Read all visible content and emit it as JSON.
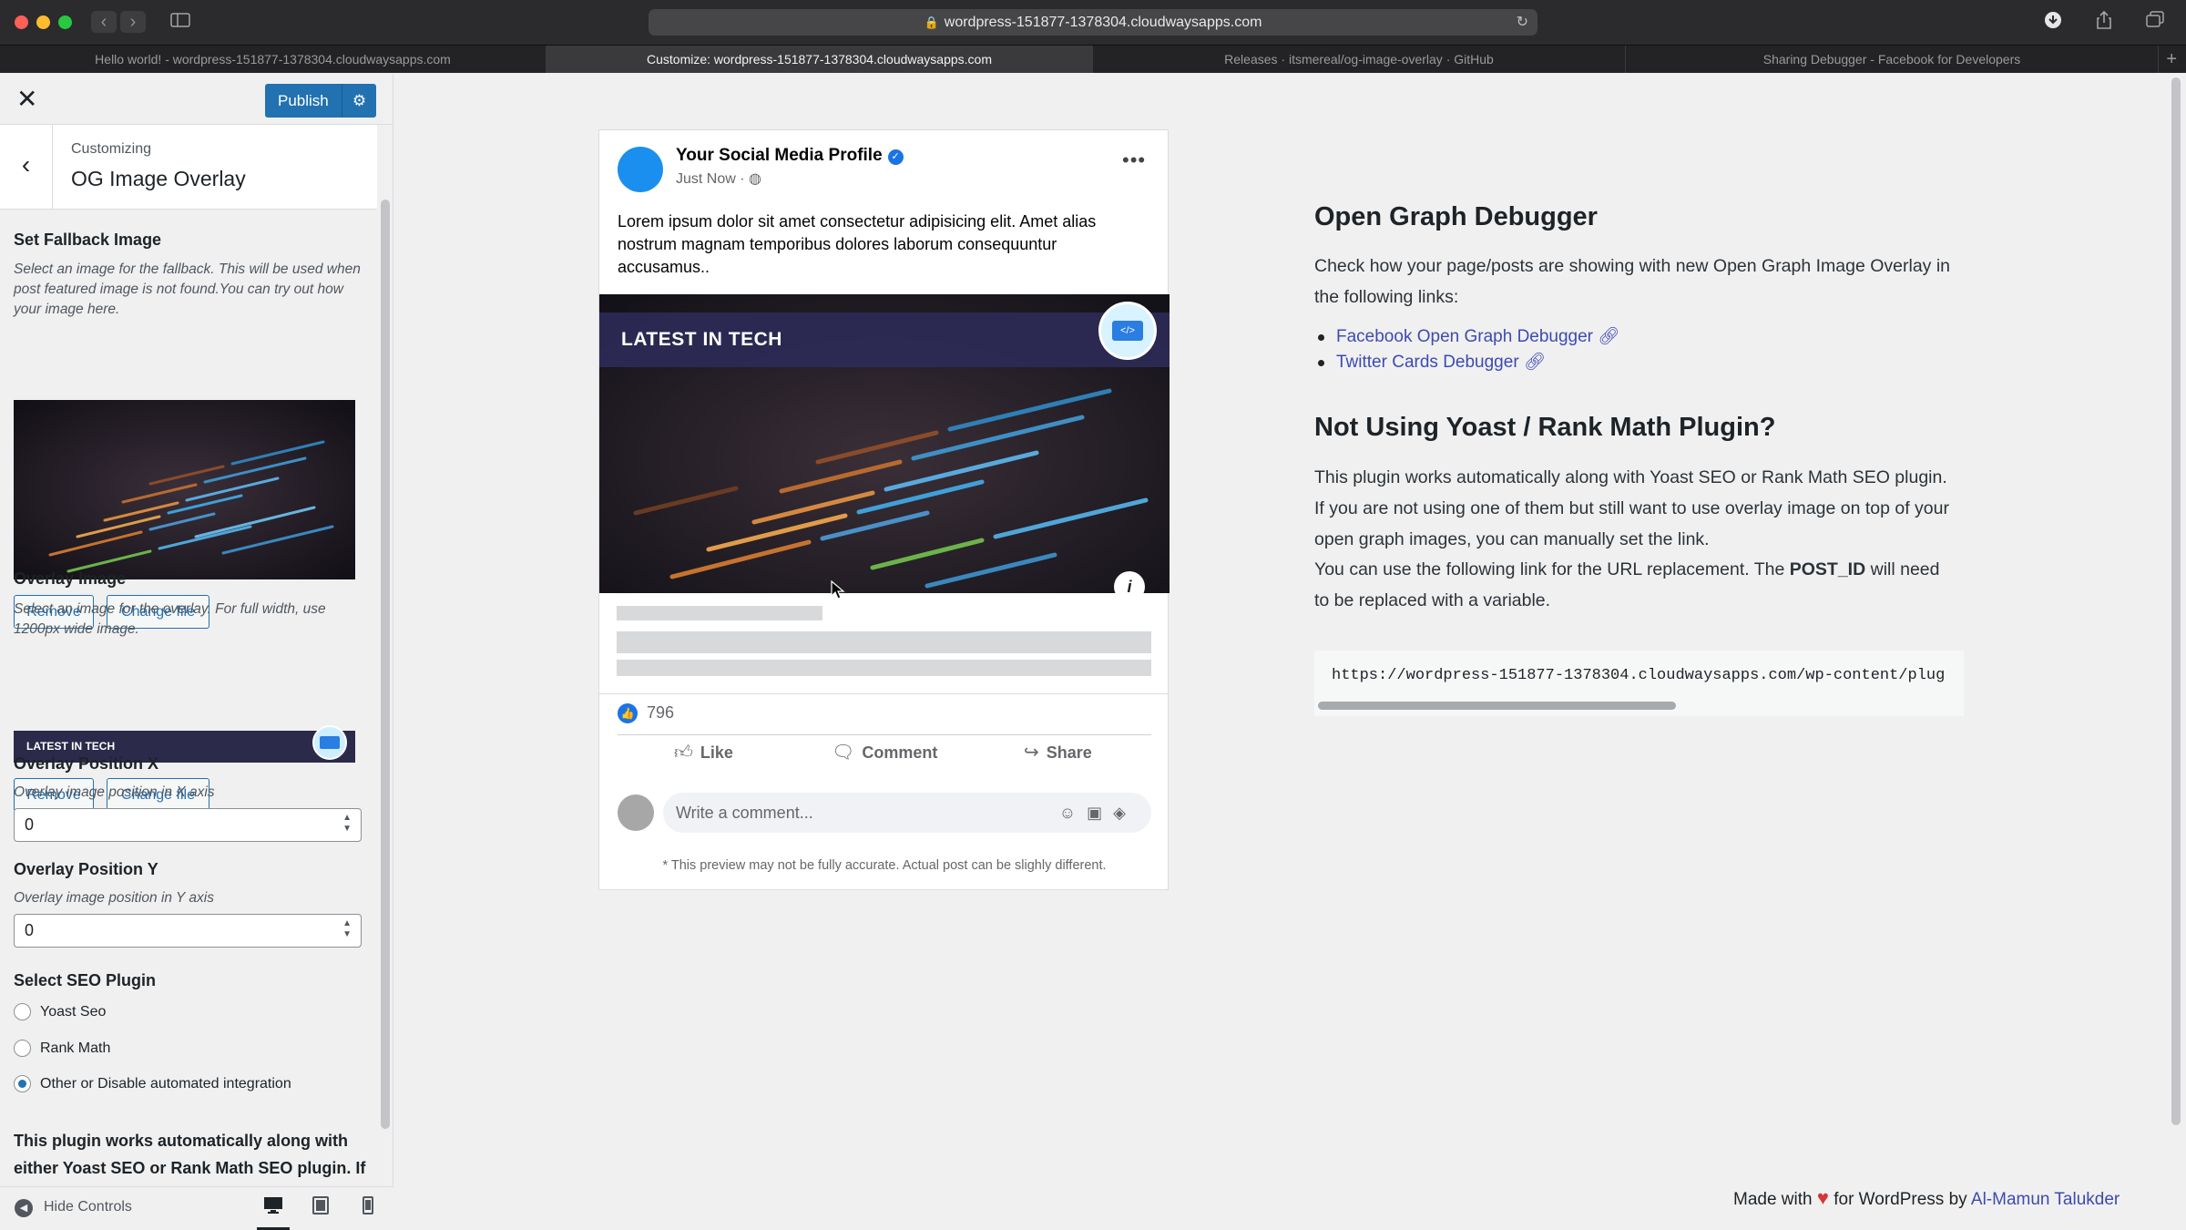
{
  "browser": {
    "url": "wordpress-151877-1378304.cloudwaysapps.com",
    "tabs": [
      {
        "label": "Hello world! - wordpress-151877-1378304.cloudwaysapps.com"
      },
      {
        "label": "Customize: wordpress-151877-1378304.cloudwaysapps.com"
      },
      {
        "label": "Releases · itsmereal/og-image-overlay · GitHub"
      },
      {
        "label": "Sharing Debugger - Facebook for Developers"
      }
    ],
    "active_tab": 1
  },
  "customizer": {
    "publish_label": "Publish",
    "customizing_label": "Customizing",
    "section_title": "OG Image Overlay",
    "fallback": {
      "label": "Set Fallback Image",
      "description": "Select an image for the fallback. This will be used when post featured image is not found.You can try out how your image here.",
      "remove_label": "Remove",
      "change_label": "Change file"
    },
    "overlay": {
      "label": "Overlay Image",
      "description": "Select an image for the overlay. For full width, use 1200px wide image.",
      "banner_text": "LATEST IN TECH",
      "remove_label": "Remove",
      "change_label": "Change file"
    },
    "pos_x": {
      "label": "Overlay Position X",
      "description": "Overlay image position in X axis",
      "value": "0"
    },
    "pos_y": {
      "label": "Overlay Position Y",
      "description": "Overlay image position in Y axis",
      "value": "0"
    },
    "seo": {
      "label": "Select SEO Plugin",
      "options": [
        "Yoast Seo",
        "Rank Math",
        "Other or Disable automated integration"
      ],
      "selected": "Other or Disable automated integration"
    },
    "note": "This plugin works automatically along with either Yoast SEO or Rank Math SEO plugin. If",
    "hide_controls": "Hide Controls"
  },
  "fb_preview": {
    "profile_name": "Your Social Media Profile",
    "time": "Just Now ·",
    "post_text": "Lorem ipsum dolor sit amet consectetur adipisicing elit. Amet alias nostrum magnam temporibus dolores laborum consequuntur accusamus..",
    "banner_text": "LATEST IN TECH",
    "likes": "796",
    "like_label": "Like",
    "comment_label": "Comment",
    "share_label": "Share",
    "comment_placeholder": "Write a comment...",
    "note": "* This preview may not be fully accurate. Actual post can be slighly different."
  },
  "doc": {
    "title1": "Open Graph Debugger",
    "intro": "Check how your page/posts are showing with new Open Graph Image Overlay in the following links:",
    "links": [
      "Facebook Open Graph Debugger",
      "Twitter Cards Debugger"
    ],
    "title2": "Not Using Yoast / Rank Math Plugin?",
    "para1": "This plugin works automatically along with Yoast SEO or Rank Math SEO plugin. If you are not using one of them but still want to use overlay image on top of your open graph images, you can manually set the link.",
    "para2_pre": "You can use the following link for the URL replacement. The ",
    "para2_bold": "POST_ID",
    "para2_post": " will need to be replaced with a variable.",
    "code": "https://wordpress-151877-1378304.cloudwaysapps.com/wp-content/plug",
    "footer_pre": "Made with",
    "footer_mid": "for WordPress by",
    "footer_author": "Al-Mamun Talukder"
  },
  "colors": {
    "wp_blue": "#2271b1",
    "fb_blue": "#1b74e4",
    "link": "#3c4bb0",
    "heart": "#d63638"
  }
}
